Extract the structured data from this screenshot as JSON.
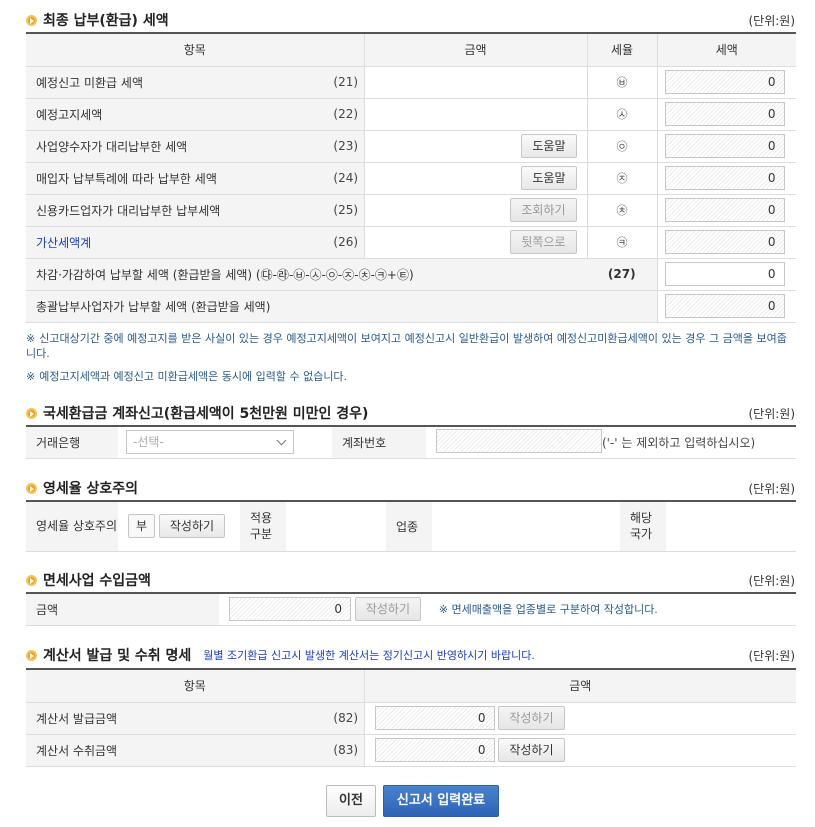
{
  "section1": {
    "title": "최종 납부(환급) 세액",
    "unit": "(단위:원)",
    "headers": [
      "항목",
      "금액",
      "세율",
      "세액"
    ],
    "rows": [
      {
        "label": "예정신고 미환급 세액",
        "num": "(21)",
        "button": "",
        "rate": "㉥",
        "value": "0"
      },
      {
        "label": "예정고지세액",
        "num": "(22)",
        "button": "",
        "rate": "㉦",
        "value": "0"
      },
      {
        "label": "사업양수자가 대리납부한 세액",
        "num": "(23)",
        "button": "도움말",
        "rate": "㉧",
        "value": "0"
      },
      {
        "label": "매입자 납부특례에 따라 납부한 세액",
        "num": "(24)",
        "button": "도움말",
        "rate": "㉨",
        "value": "0"
      },
      {
        "label": "신용카드업자가 대리납부한 납부세액",
        "num": "(25)",
        "button": "조회하기",
        "rate": "㉩",
        "value": "0"
      },
      {
        "label": "가산세액계",
        "num": "(26)",
        "button": "뒷쪽으로",
        "rate": "㉪",
        "value": "0"
      }
    ],
    "deduct_label": "차감·가감하여 납부할 세액 (환급받을 세액) (㉰-㉱-㉥-㉦-㉧-㉨-㉩-㉪+㉫)",
    "deduct_num": "(27)",
    "deduct_value": "0",
    "total_label": "총괄납부사업자가 납부할 세액 (환급받을 세액)",
    "total_value": "0"
  },
  "notes": [
    "신고대상기간 중에 예정고지를 받은 사실이 있는 경우 예정고지세액이 보여지고 예정신고시 일반환급이 발생하여 예정신고미환급세액이 있는 경우 그 금액을 보여줍니다.",
    "예정고지세액과 예정신고 미환급세액은 동시에 입력할 수 없습니다."
  ],
  "note_mark": "※",
  "section2": {
    "title": "국세환급금 계좌신고(환급세액이 5천만원 미만인 경우)",
    "unit": "(단위:원)",
    "bank_label": "거래은행",
    "bank_placeholder": "-선택-",
    "account_label": "계좌번호",
    "account_hint": "('-' 는 제외하고 입력하십시오)"
  },
  "section3": {
    "title": "영세율 상호주의",
    "unit": "(단위:원)",
    "label": "영세율 상호주의",
    "value": "부",
    "button": "작성하기",
    "apply_label": "적용 구분",
    "industry_label": "업종",
    "country_label": "해당 국가"
  },
  "section4": {
    "title": "면세사업 수입금액",
    "unit": "(단위:원)",
    "label": "금액",
    "value": "0",
    "button": "작성하기",
    "note": "※ 면세매출액을 업종별로 구분하여 작성합니다."
  },
  "section5": {
    "title": "계산서 발급 및 수취 명세",
    "subnote": "월별 조기환급 신고시 발생한 계산서는 정기신고시 반영하시기 바랍니다.",
    "unit": "(단위:원)",
    "headers": [
      "항목",
      "금액"
    ],
    "rows": [
      {
        "label": "계산서 발급금액",
        "num": "(82)",
        "value": "0",
        "button": "작성하기"
      },
      {
        "label": "계산서 수취금액",
        "num": "(83)",
        "value": "0",
        "button": "작성하기"
      }
    ]
  },
  "footer": {
    "prev": "이전",
    "done": "신고서 입력완료"
  },
  "colors": {
    "accent_button": "#2e64b4",
    "link": "#1a3dc0",
    "note": "#2a5a8a"
  }
}
